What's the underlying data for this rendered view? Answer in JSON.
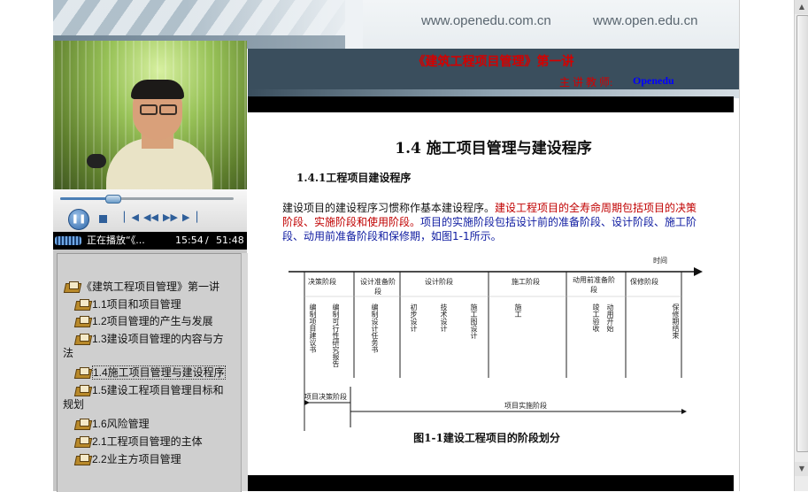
{
  "header": {
    "url_left": "www.openedu.com.cn",
    "url_right": "www.open.edu.cn"
  },
  "player": {
    "status_prefix": "正在播放“《...",
    "time_current": "15:54",
    "time_total": "51:48",
    "progress_fraction": 0.31
  },
  "toc": {
    "items": [
      {
        "label": "《建筑工程项目管理》第一讲",
        "level": 0
      },
      {
        "label": "1.1项目和项目管理",
        "level": 1
      },
      {
        "label": "1.2项目管理的产生与发展",
        "level": 1
      },
      {
        "label": "1.3建设项目管理的内容与方",
        "cont": "法",
        "level": 1
      },
      {
        "label": "1.4施工项目管理与建设程序",
        "level": 1,
        "selected": true
      },
      {
        "label": "1.5建设工程项目管理目标和",
        "cont": "规划",
        "level": 1
      },
      {
        "label": "1.6风险管理",
        "level": 1
      },
      {
        "label": "2.1工程项目管理的主体",
        "level": 1
      },
      {
        "label": "2.2业主方项目管理",
        "level": 1
      }
    ]
  },
  "content": {
    "course_title": "《建筑工程项目管理》第一讲",
    "teacher_label": "主 讲 教 师:",
    "teacher_name": "Openedu",
    "section_title": "1.4  施工项目管理与建设程序",
    "subsection_title": "1.4.1工程项目建设程序",
    "paragraph": {
      "part1": "建设项目的建设程序习惯称作基本建设程序。",
      "part2": "建设工程项目的全寿命周期包括项目的决策阶段、实施阶段和使用阶段。",
      "part3": "项目的实施阶段包括设计前的准备阶段、设计阶段、施工阶段、动用前准备阶段和保修期，如图1-1所示。"
    },
    "figure": {
      "time_label": "时间",
      "phases": [
        "决策阶段",
        "设计准备阶段",
        "设计阶段",
        "施工阶段",
        "动用前准备阶段",
        "保修阶段"
      ],
      "tasks": [
        "编制项目建议书",
        "编制可行性研究报告",
        "编制设计任务书",
        "初步设计",
        "技术设计",
        "施工图设计",
        "施工",
        "竣工验收",
        "动用开始",
        "保修期结束"
      ],
      "decision_label": "项目决策阶段",
      "implementation_label": "项目实施阶段",
      "caption": "图1-1建设工程项目的阶段划分"
    }
  },
  "colors": {
    "title_bar": "#3a4e5d",
    "title_red": "#d40000",
    "teacher_blue": "#0000ff"
  },
  "icons": [
    "pause-icon",
    "stop-icon",
    "skip-back-icon",
    "rewind-icon",
    "fast-forward-icon",
    "skip-forward-icon",
    "book-icon",
    "scroll-up-icon",
    "scroll-down-icon"
  ]
}
